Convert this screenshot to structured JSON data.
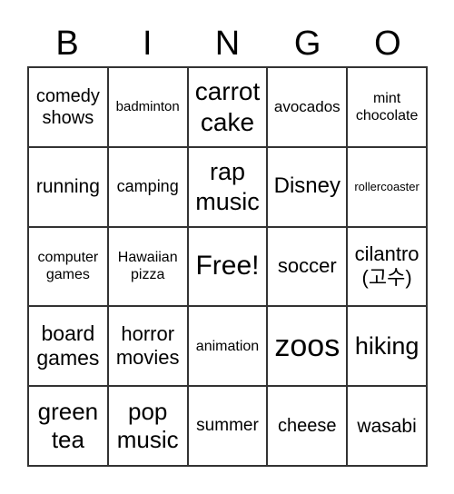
{
  "header": [
    "B",
    "I",
    "N",
    "G",
    "O"
  ],
  "cells": [
    "comedy shows",
    "badminton",
    "carrot cake",
    "avocados",
    "mint chocolate",
    "running",
    "camping",
    "rap music",
    "Disney",
    "rollercoaster",
    "computer games",
    "Hawaiian pizza",
    "Free!",
    "soccer",
    "cilantro (고수)",
    "board games",
    "horror movies",
    "animation",
    "zoos",
    "hiking",
    "green tea",
    "pop music",
    "summer",
    "cheese",
    "wasabi"
  ]
}
